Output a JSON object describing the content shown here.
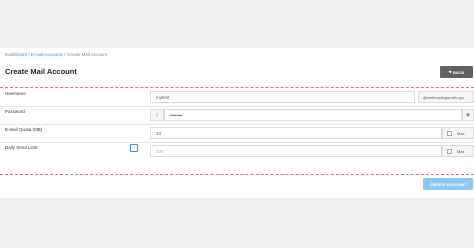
{
  "breadcrumb": {
    "items": [
      "Dashboard",
      "E-mail Accounts",
      "Create Mail Account"
    ],
    "separator": " / "
  },
  "page": {
    "title": "Create Mail Account",
    "back_label": "BACK"
  },
  "form": {
    "username": {
      "label": "Username",
      "value": "mytest",
      "domain_suffix": "@webhostingsmith.xyz"
    },
    "password": {
      "label": "Password",
      "value": "••••••••"
    },
    "quota": {
      "label": "E-mail Quota (MB)",
      "value": "10",
      "max_label": "Max"
    },
    "send_limit": {
      "label": "Daily Send Limit",
      "help": "?",
      "placeholder": "200",
      "max_label": "Max"
    },
    "submit_label": "CREATE ACCOUNT"
  },
  "colors": {
    "back_button": "#5f6163",
    "create_button": "#8cc8f0",
    "dashed_border": "#e57373",
    "link": "#4a90c8"
  }
}
